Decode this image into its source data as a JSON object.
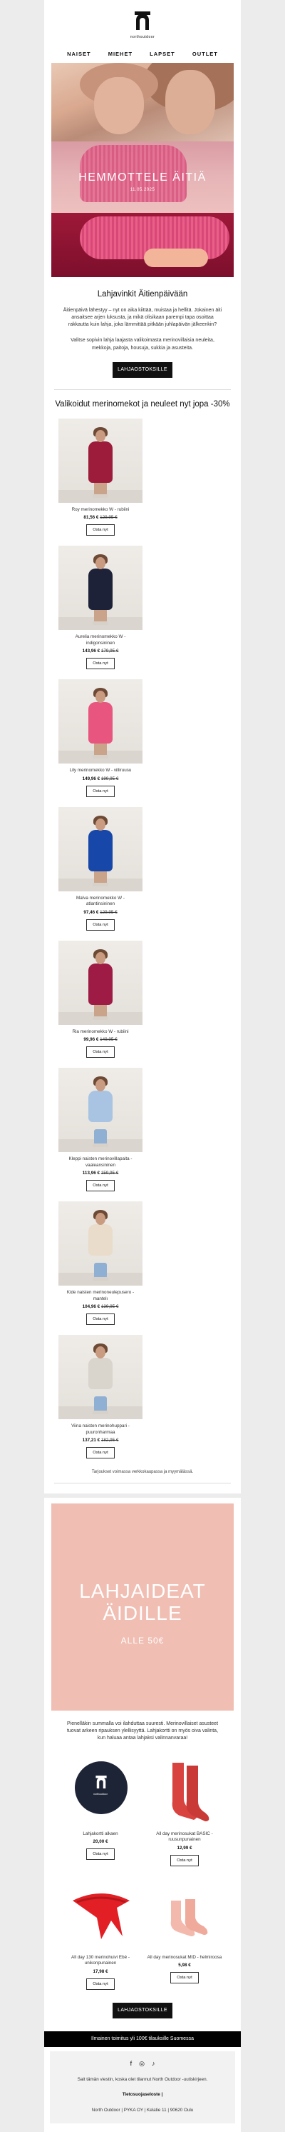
{
  "brand": {
    "name": "northoutdoor"
  },
  "nav": [
    "NAISET",
    "MIEHET",
    "LAPSET",
    "OUTLET"
  ],
  "hero": {
    "title": "HEMMOTTELE ÄITIÄ",
    "subtitle": "11.05.2025"
  },
  "intro": {
    "title": "Lahjavinkit Äitienpäivään",
    "para1": "Äitienpäivä lähestyy – nyt on aika kiittää, muistaa ja hellitä. Jokainen äiti ansaitsee arjen luksusta, ja mikä olisikaan parempi tapa osoittaa rakkautta kuin lahja, joka lämmittää pitkään juhlapäivän jälkeenkin?",
    "para2": "Valitse sopivin lahja laajasta valikoimasta merinovillaisia neuleita, mekkoja, paitoja, housuja, sukkia ja asusteita.",
    "button": "LAHJAOSTOKSILLE"
  },
  "sale": {
    "title": "Valikoidut merinomekot ja neuleet nyt jopa -30%",
    "button_label": "Osta nyt",
    "products": [
      {
        "name": "Roy merinomekko W - rubiini",
        "price": "81,56 €",
        "old": "129,95 €",
        "color": "#9d1b3b"
      },
      {
        "name": "Aurelia merinomekko W - indigonsininen",
        "price": "143,96 €",
        "old": "179,95 €",
        "color": "#1d2238"
      },
      {
        "name": "Lily merinomekko W - villiruusu",
        "price": "149,96 €",
        "old": "199,95 €",
        "color": "#e8557f"
      },
      {
        "name": "Malva merinomekko W - atlantinsininen",
        "price": "97,46 €",
        "old": "129,95 €",
        "color": "#1747a8"
      },
      {
        "name": "Ria merinomekko W - rubiini",
        "price": "99,96 €",
        "old": "149,95 €",
        "color": "#9d1b45"
      },
      {
        "name": "Kleppi naisten merinovillapaita - vaaleansininen",
        "price": "113,96 €",
        "old": "159,95 €",
        "color": "#a9c4e2"
      },
      {
        "name": "Kide naisten merinoneulepusero - mantelı",
        "price": "104,96 €",
        "old": "139,95 €",
        "color": "#e9dccb"
      },
      {
        "name": "Viina naisten merinohuppari - puuronharmaa",
        "price": "137,21 €",
        "old": "182,95 €",
        "color": "#d9d4cc"
      }
    ],
    "note": "Tarjoukset voimassa verkkokaupassa ja myymälässä."
  },
  "gifts": {
    "title": "LAHJAIDEAT ÄIDILLE",
    "subtitle": "ALLE 50€",
    "para": "Pienelläkin summalla voi ilahduttaa suuresti. Merinovillaiset asusteet tuovat arkeen ripauksen ylellisyyttä. Lahjakortti on myös oiva valinta, kun haluaa antaa lahjaksi valinnanvaraa!",
    "button_label": "Osta nyt",
    "items": [
      {
        "name": "Lahjakortti alkaen",
        "price": "20,00 €",
        "icon": "gift-card-icon"
      },
      {
        "name": "All day merinosukat BASIC - ruusunpunainen",
        "price": "12,99 €",
        "icon": "socks-icon"
      },
      {
        "name": "All day 130 merinohuivi Ebé - unikonpunainen",
        "price": "17,98 €",
        "icon": "scarf-icon"
      },
      {
        "name": "All day merinosukat MID - helmiroosa",
        "price": "5,98 €",
        "icon": "socks-icon"
      }
    ],
    "cta": "LAHJAOSTOKSILLE"
  },
  "footer": {
    "shipping": "Ilmainen toimitus yli 100€ tilauksille Suomessa",
    "socials": [
      "f",
      "◎",
      "♪"
    ],
    "info": "Sait tämän viestin, koska olet tilannut North Outdoor -uutiskirjeen.",
    "privacy": "Tietosuojaseloste |",
    "address": "North Outdoor | PYKA OY | Kelatie 11 | 90620 Oulu"
  }
}
